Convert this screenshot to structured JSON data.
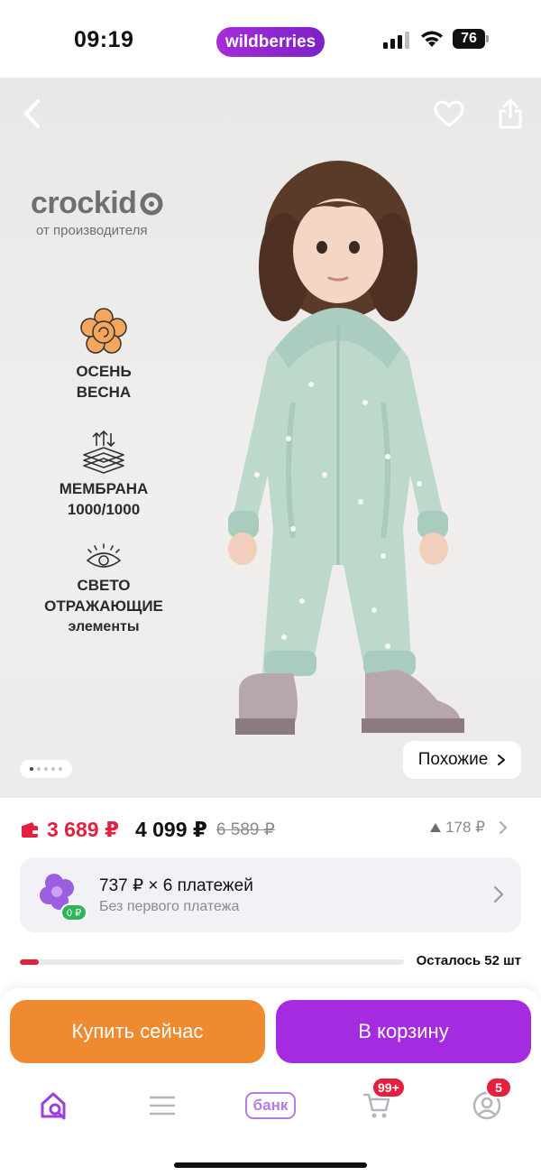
{
  "status_bar": {
    "time": "09:19",
    "brand": "wildberries",
    "battery": "76"
  },
  "hero": {
    "brand_name": "crockid",
    "brand_sub": "от производителя",
    "features": [
      {
        "icon": "flower-icon",
        "line1": "ОСЕНЬ",
        "line2": "ВЕСНА"
      },
      {
        "icon": "membrane-icon",
        "line1": "МЕМБРАНА",
        "line2": "1000/1000"
      },
      {
        "icon": "eye-icon",
        "line1": "СВЕТО",
        "line2": "ОТРАЖАЮЩИЕ",
        "line3": "элементы"
      }
    ],
    "similar_label": "Похожие",
    "carousel": {
      "total": 5,
      "active": 1
    }
  },
  "price": {
    "wallet_price": "3 689 ₽",
    "regular_price": "4 099 ₽",
    "old_price": "6 589 ₽",
    "price_change": "178 ₽"
  },
  "split": {
    "title": "737 ₽ × 6 платежей",
    "subtitle": "Без первого платежа",
    "badge": "0 ₽"
  },
  "stock": {
    "text": "Осталось 52 шт",
    "fill_fraction": 0.05
  },
  "actions": {
    "buy_now": "Купить сейчас",
    "add_to_cart": "В корзину"
  },
  "tabbar": {
    "bank_label": "банк",
    "cart_badge": "99+",
    "profile_badge": "5"
  },
  "colors": {
    "accent_purple": "#a42be0",
    "buy_orange": "#f08a30",
    "wallet_red": "#e3213f"
  }
}
